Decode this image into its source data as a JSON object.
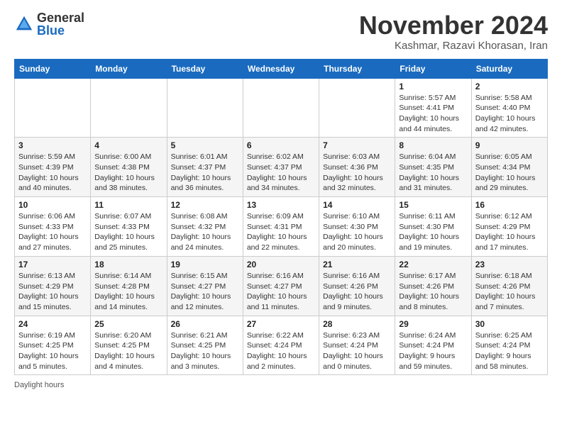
{
  "header": {
    "logo_general": "General",
    "logo_blue": "Blue",
    "month_title": "November 2024",
    "subtitle": "Kashmar, Razavi Khorasan, Iran"
  },
  "footer": {
    "daylight_label": "Daylight hours"
  },
  "calendar": {
    "headers": [
      "Sunday",
      "Monday",
      "Tuesday",
      "Wednesday",
      "Thursday",
      "Friday",
      "Saturday"
    ],
    "rows": [
      [
        {
          "day": "",
          "info": ""
        },
        {
          "day": "",
          "info": ""
        },
        {
          "day": "",
          "info": ""
        },
        {
          "day": "",
          "info": ""
        },
        {
          "day": "",
          "info": ""
        },
        {
          "day": "1",
          "info": "Sunrise: 5:57 AM\nSunset: 4:41 PM\nDaylight: 10 hours\nand 44 minutes."
        },
        {
          "day": "2",
          "info": "Sunrise: 5:58 AM\nSunset: 4:40 PM\nDaylight: 10 hours\nand 42 minutes."
        }
      ],
      [
        {
          "day": "3",
          "info": "Sunrise: 5:59 AM\nSunset: 4:39 PM\nDaylight: 10 hours\nand 40 minutes."
        },
        {
          "day": "4",
          "info": "Sunrise: 6:00 AM\nSunset: 4:38 PM\nDaylight: 10 hours\nand 38 minutes."
        },
        {
          "day": "5",
          "info": "Sunrise: 6:01 AM\nSunset: 4:37 PM\nDaylight: 10 hours\nand 36 minutes."
        },
        {
          "day": "6",
          "info": "Sunrise: 6:02 AM\nSunset: 4:37 PM\nDaylight: 10 hours\nand 34 minutes."
        },
        {
          "day": "7",
          "info": "Sunrise: 6:03 AM\nSunset: 4:36 PM\nDaylight: 10 hours\nand 32 minutes."
        },
        {
          "day": "8",
          "info": "Sunrise: 6:04 AM\nSunset: 4:35 PM\nDaylight: 10 hours\nand 31 minutes."
        },
        {
          "day": "9",
          "info": "Sunrise: 6:05 AM\nSunset: 4:34 PM\nDaylight: 10 hours\nand 29 minutes."
        }
      ],
      [
        {
          "day": "10",
          "info": "Sunrise: 6:06 AM\nSunset: 4:33 PM\nDaylight: 10 hours\nand 27 minutes."
        },
        {
          "day": "11",
          "info": "Sunrise: 6:07 AM\nSunset: 4:33 PM\nDaylight: 10 hours\nand 25 minutes."
        },
        {
          "day": "12",
          "info": "Sunrise: 6:08 AM\nSunset: 4:32 PM\nDaylight: 10 hours\nand 24 minutes."
        },
        {
          "day": "13",
          "info": "Sunrise: 6:09 AM\nSunset: 4:31 PM\nDaylight: 10 hours\nand 22 minutes."
        },
        {
          "day": "14",
          "info": "Sunrise: 6:10 AM\nSunset: 4:30 PM\nDaylight: 10 hours\nand 20 minutes."
        },
        {
          "day": "15",
          "info": "Sunrise: 6:11 AM\nSunset: 4:30 PM\nDaylight: 10 hours\nand 19 minutes."
        },
        {
          "day": "16",
          "info": "Sunrise: 6:12 AM\nSunset: 4:29 PM\nDaylight: 10 hours\nand 17 minutes."
        }
      ],
      [
        {
          "day": "17",
          "info": "Sunrise: 6:13 AM\nSunset: 4:29 PM\nDaylight: 10 hours\nand 15 minutes."
        },
        {
          "day": "18",
          "info": "Sunrise: 6:14 AM\nSunset: 4:28 PM\nDaylight: 10 hours\nand 14 minutes."
        },
        {
          "day": "19",
          "info": "Sunrise: 6:15 AM\nSunset: 4:27 PM\nDaylight: 10 hours\nand 12 minutes."
        },
        {
          "day": "20",
          "info": "Sunrise: 6:16 AM\nSunset: 4:27 PM\nDaylight: 10 hours\nand 11 minutes."
        },
        {
          "day": "21",
          "info": "Sunrise: 6:16 AM\nSunset: 4:26 PM\nDaylight: 10 hours\nand 9 minutes."
        },
        {
          "day": "22",
          "info": "Sunrise: 6:17 AM\nSunset: 4:26 PM\nDaylight: 10 hours\nand 8 minutes."
        },
        {
          "day": "23",
          "info": "Sunrise: 6:18 AM\nSunset: 4:26 PM\nDaylight: 10 hours\nand 7 minutes."
        }
      ],
      [
        {
          "day": "24",
          "info": "Sunrise: 6:19 AM\nSunset: 4:25 PM\nDaylight: 10 hours\nand 5 minutes."
        },
        {
          "day": "25",
          "info": "Sunrise: 6:20 AM\nSunset: 4:25 PM\nDaylight: 10 hours\nand 4 minutes."
        },
        {
          "day": "26",
          "info": "Sunrise: 6:21 AM\nSunset: 4:25 PM\nDaylight: 10 hours\nand 3 minutes."
        },
        {
          "day": "27",
          "info": "Sunrise: 6:22 AM\nSunset: 4:24 PM\nDaylight: 10 hours\nand 2 minutes."
        },
        {
          "day": "28",
          "info": "Sunrise: 6:23 AM\nSunset: 4:24 PM\nDaylight: 10 hours\nand 0 minutes."
        },
        {
          "day": "29",
          "info": "Sunrise: 6:24 AM\nSunset: 4:24 PM\nDaylight: 9 hours\nand 59 minutes."
        },
        {
          "day": "30",
          "info": "Sunrise: 6:25 AM\nSunset: 4:24 PM\nDaylight: 9 hours\nand 58 minutes."
        }
      ]
    ]
  }
}
